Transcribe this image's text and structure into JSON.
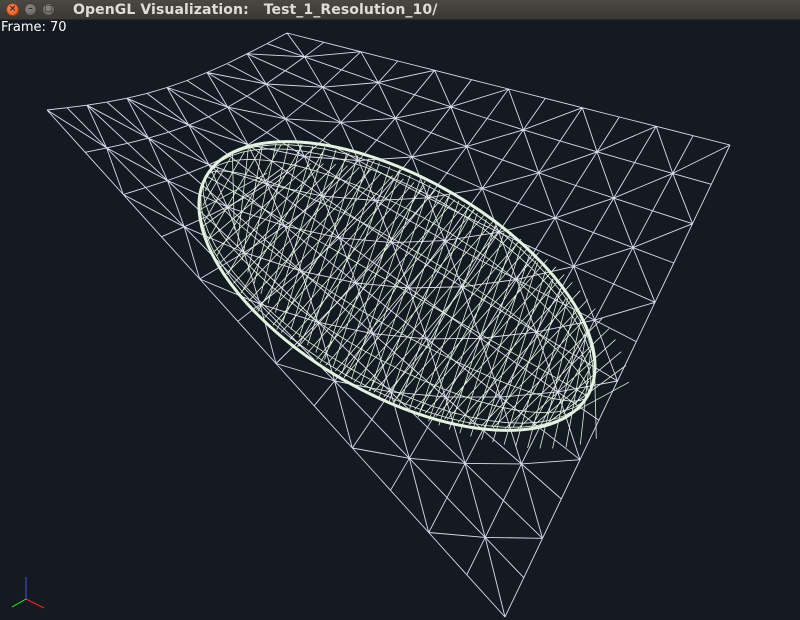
{
  "window": {
    "title": "OpenGL Visualization:   Test_1_Resolution_10/",
    "close_glyph": "×",
    "minimize_glyph": "–",
    "maximize_glyph": "□"
  },
  "overlay": {
    "frame_label": "Frame:",
    "frame_value": "70"
  },
  "scene": {
    "background_color": "#141a22",
    "mesh_color": "#dcdcf0",
    "ellipsoid_color": "#e4f2e0"
  },
  "axis_gizmo": {
    "x_color": "#ff2020",
    "y_color": "#20ff20",
    "z_color": "#4a4aff"
  }
}
